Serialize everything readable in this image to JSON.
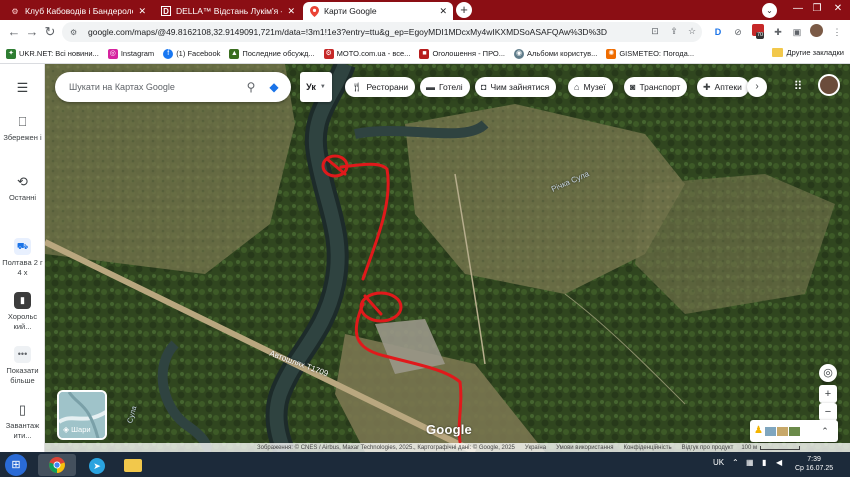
{
  "browser": {
    "tabs": [
      {
        "title": "Клуб Кабоводів і Бандерологів.С",
        "icon": "motorcycle-icon",
        "active": false
      },
      {
        "title": "DELLA™ Відстань Лукім'я - Полт",
        "icon": "della-icon",
        "active": false
      },
      {
        "title": "Карти Google",
        "icon": "google-maps-icon",
        "active": true
      }
    ],
    "url": "google.com/maps/@49.8162108,32.9149091,721m/data=!3m1!1e3?entry=ttu&g_ep=EgoyMDI1MDcxMy4wIKXMDSoASAFQAw%3D%3D",
    "bookmarks": [
      {
        "label": "UKR.NET: Всі новини...",
        "color": "#2e7d32"
      },
      {
        "label": "Instagram",
        "color": "#d6249f"
      },
      {
        "label": "(1) Facebook",
        "color": "#1877f2"
      },
      {
        "label": "Последние обсужд...",
        "color": "#3a6e1f"
      },
      {
        "label": "MOTO.com.ua - все...",
        "color": "#c62828"
      },
      {
        "label": "Оголошення - ПРО...",
        "color": "#b71c1c"
      },
      {
        "label": "Альбоми користув...",
        "color": "#607d8b"
      },
      {
        "label": "GISMETEO: Погода...",
        "color": "#ef6c00"
      }
    ],
    "other_bookmarks": "Другие закладки",
    "extension_badge": "70"
  },
  "rail": {
    "items": [
      {
        "icon": "menu-icon",
        "label": ""
      },
      {
        "icon": "bookmark-icon",
        "label": "Збережен і"
      },
      {
        "icon": "history-icon",
        "label": "Останні"
      },
      {
        "icon": "car-icon",
        "label": "Полтава 2 г 4 х"
      },
      {
        "icon": "phone-icon",
        "label": "Хорольс кий..."
      },
      {
        "icon": "more-icon",
        "label": "Показати більше"
      },
      {
        "icon": "phone-download-icon",
        "label": "Завантаж ити..."
      }
    ]
  },
  "map": {
    "search_placeholder": "Шукати на Картах Google",
    "language": "Ук",
    "chips": [
      {
        "label": "Ресторани",
        "icon": "restaurant-icon"
      },
      {
        "label": "Готелі",
        "icon": "hotel-icon"
      },
      {
        "label": "Чим зайнятися",
        "icon": "camera-icon"
      },
      {
        "label": "Музеї",
        "icon": "museum-icon"
      },
      {
        "label": "Транспорт",
        "icon": "transit-icon"
      },
      {
        "label": "Аптеки",
        "icon": "pharmacy-icon"
      }
    ],
    "layers_label": "Шари",
    "road_label": "Автошлях Т1709",
    "river_label": "Річка Сула",
    "river_label_2": "Сула",
    "google_logo": "Google",
    "attribution": "Зображення: © CNES / Airbus, Maxar Technologies, 2025., Картографічні дані: © Google, 2025",
    "footer_links": [
      "Україна",
      "Умови використання",
      "Конфіденційність",
      "Відгук про продукт"
    ],
    "scale_label": "100 м"
  },
  "taskbar": {
    "language": "UK",
    "time": "7:39",
    "date": "Ср 16.07.25"
  }
}
